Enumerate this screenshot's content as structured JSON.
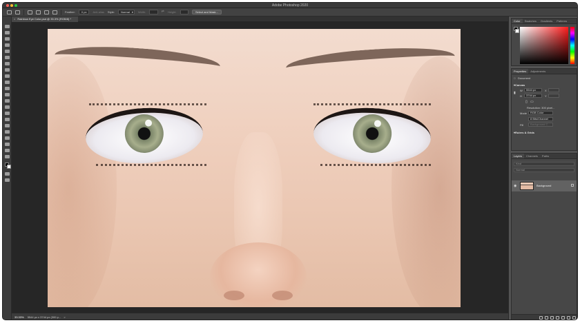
{
  "app": {
    "title": "Adobe Photoshop 2020"
  },
  "options_bar": {
    "feather_label": "Feather:",
    "feather_value": "0 px",
    "antialias_label": "Anti-alias",
    "style_label": "Style:",
    "style_value": "Normal",
    "width_label": "Width:",
    "height_label": "Height:",
    "select_mask_label": "Select and Mask..."
  },
  "document": {
    "tab_title": "Rainbow Eye Color.psd @ 33.3% (RGB/8) *"
  },
  "status_bar": {
    "zoom": "33.33%",
    "info": "5544 px x 3744 px (300 p...",
    "arrow": ">"
  },
  "color_panel": {
    "tabs": [
      "Color",
      "Swatches",
      "Gradients",
      "Patterns"
    ],
    "foreground": "#000000",
    "background": "#ffffff",
    "selected_hue": "#ff1d1d"
  },
  "properties_panel": {
    "tabs": [
      "Properties",
      "Adjustments"
    ],
    "doc_label": "Document",
    "canvas_heading": "Canvas",
    "width_label": "W",
    "width_value": "5544 px",
    "height_label": "H",
    "height_value": "3744 px",
    "x_label": "X",
    "y_label": "Y",
    "resolution": "Resolution: 300 pixel...",
    "mode_label": "Mode",
    "mode_value": "RGB Color",
    "depth_value": "8 Bits/Channel",
    "fill_label": "Fill",
    "fill_value": "Background C...",
    "rulers_heading": "Rulers & Grids"
  },
  "layers_panel": {
    "tabs": [
      "Layers",
      "Channels",
      "Paths"
    ],
    "kind_filter": "Kind",
    "blend_mode": "Normal",
    "opacity": "Opacity:",
    "lock_label": "Lock:",
    "fill_label": "Fill:",
    "layers": [
      {
        "name": "Background",
        "visible": true,
        "locked": true
      }
    ]
  }
}
